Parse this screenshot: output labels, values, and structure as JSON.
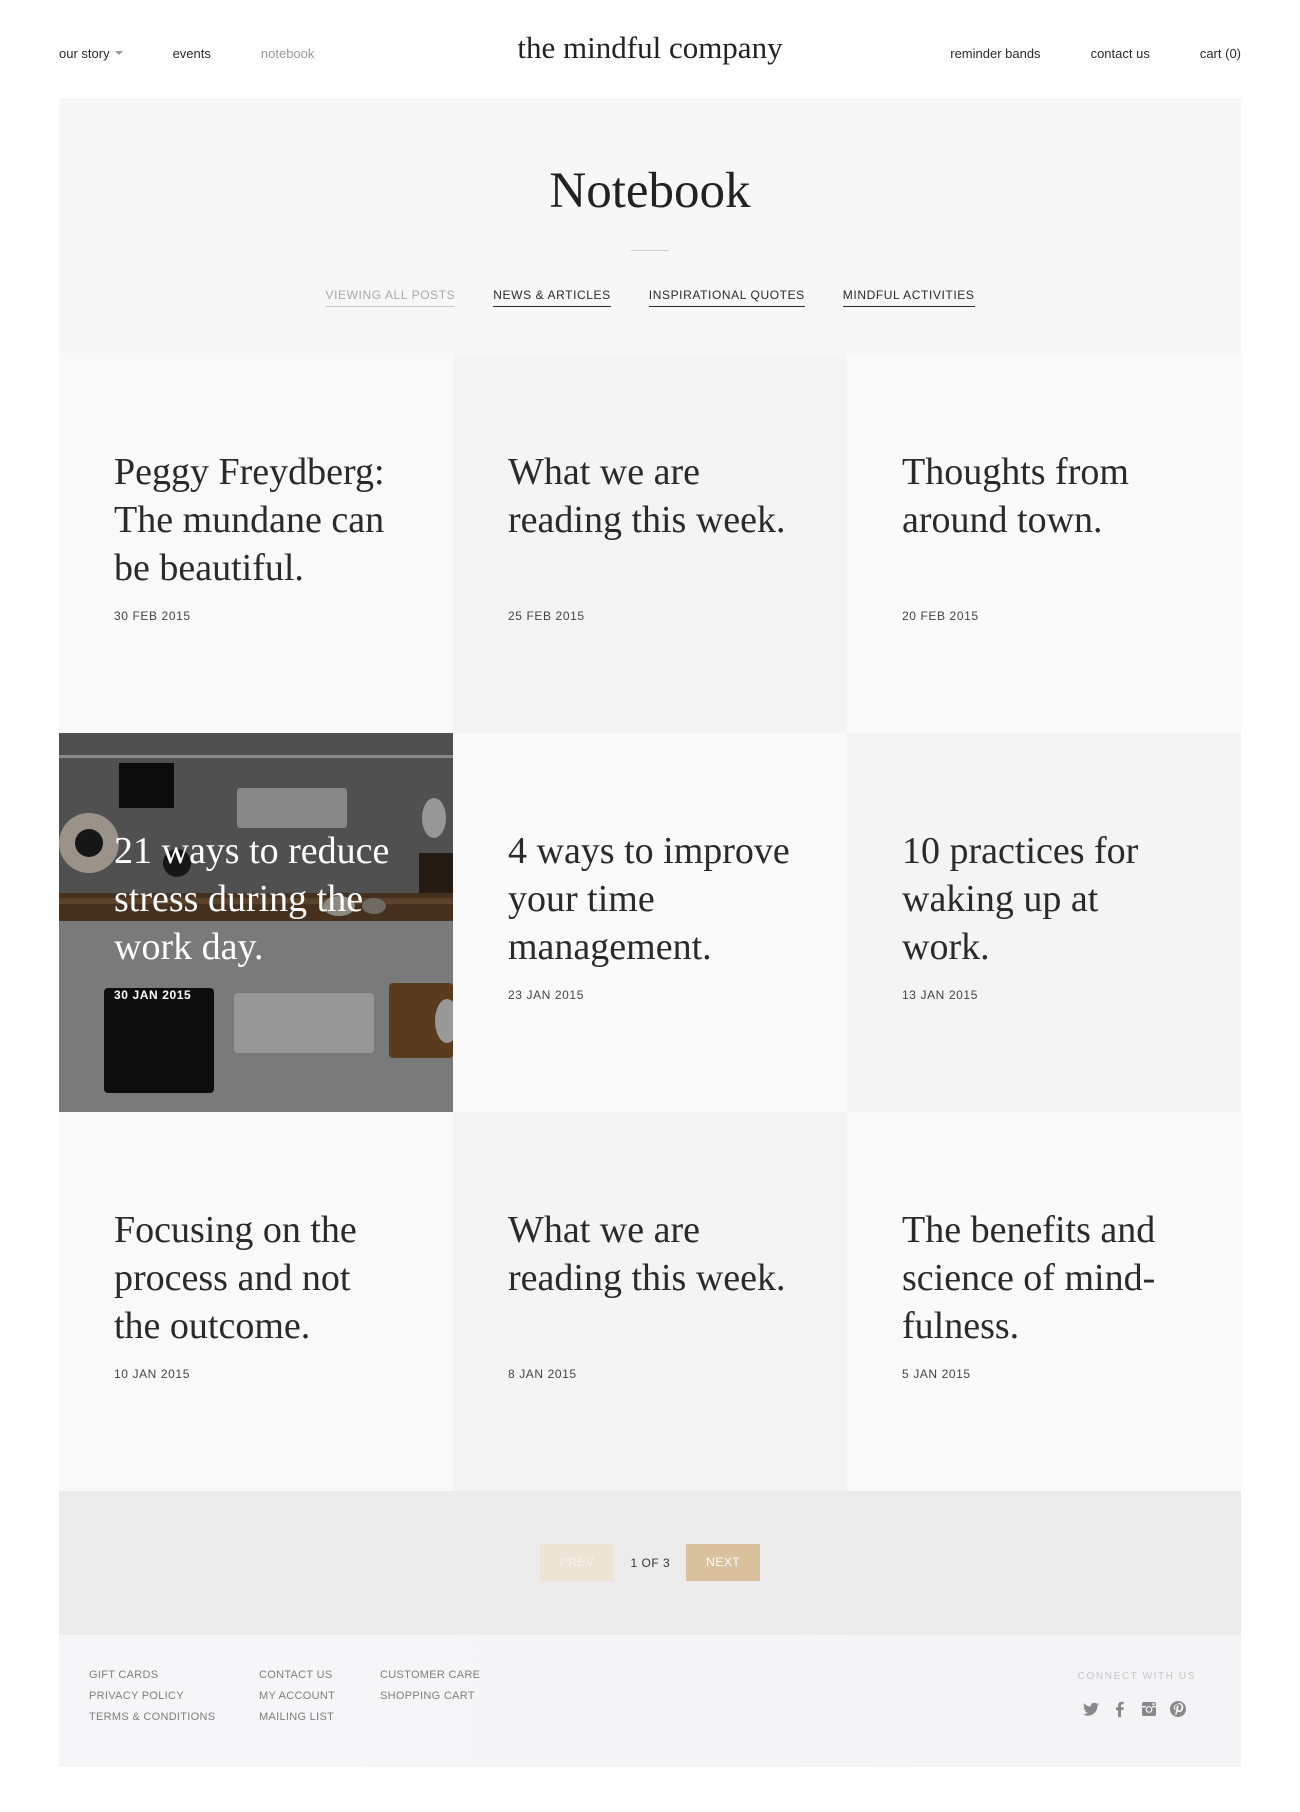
{
  "header": {
    "brand": "the mindful company",
    "nav_left": [
      {
        "label": "our story"
      },
      {
        "label": "events"
      },
      {
        "label": "notebook"
      }
    ],
    "nav_right": [
      {
        "label": "reminder bands"
      },
      {
        "label": "contact us"
      },
      {
        "label": "cart (0)"
      }
    ]
  },
  "hero": {
    "title": "Notebook",
    "filters": [
      {
        "label": "VIEWING ALL POSTS"
      },
      {
        "label": "NEWS & ARTICLES"
      },
      {
        "label": "INSPIRATIONAL QUOTES"
      },
      {
        "label": "MINDFUL ACTIVITIES"
      }
    ]
  },
  "posts": [
    {
      "title": "Peggy Freydberg: The mundane can be beautiful.",
      "date": "30 FEB 2015"
    },
    {
      "title": "What we are reading this week.",
      "date": "25 FEB 2015"
    },
    {
      "title": "Thoughts from around town.",
      "date": "20 FEB 2015"
    },
    {
      "title": "21 ways to reduce stress during the work day.",
      "date": "30 JAN 2015"
    },
    {
      "title": "4 ways to improve your time management.",
      "date": "23 JAN 2015"
    },
    {
      "title": "10 practices for waking up at work.",
      "date": "13 JAN 2015"
    },
    {
      "title": "Focusing on the process and not the outcome.",
      "date": "10 JAN 2015"
    },
    {
      "title": "What we are reading this week.",
      "date": "8 JAN 2015"
    },
    {
      "title": "The benefits and science of mind-fulness.",
      "date": "5 JAN 2015"
    }
  ],
  "pagination": {
    "prev": "PREV",
    "info": "1 OF 3",
    "next": "NEXT"
  },
  "footer": {
    "col1": [
      "GIFT CARDS",
      "PRIVACY POLICY",
      "TERMS & CONDITIONS"
    ],
    "col2": [
      "CONTACT US",
      "MY ACCOUNT",
      "MAILING LIST"
    ],
    "col3": [
      "CUSTOMER CARE",
      "SHOPPING CART"
    ],
    "connect_label": "CONNECT WITH US",
    "socials": [
      "twitter-icon",
      "facebook-icon",
      "instagram-icon",
      "pinterest-icon"
    ]
  },
  "colors": {
    "accent": "#d8c19c",
    "accent_light": "#ede4d6",
    "hero_bg": "#f7f7f7",
    "pager_bg": "#ececec"
  }
}
